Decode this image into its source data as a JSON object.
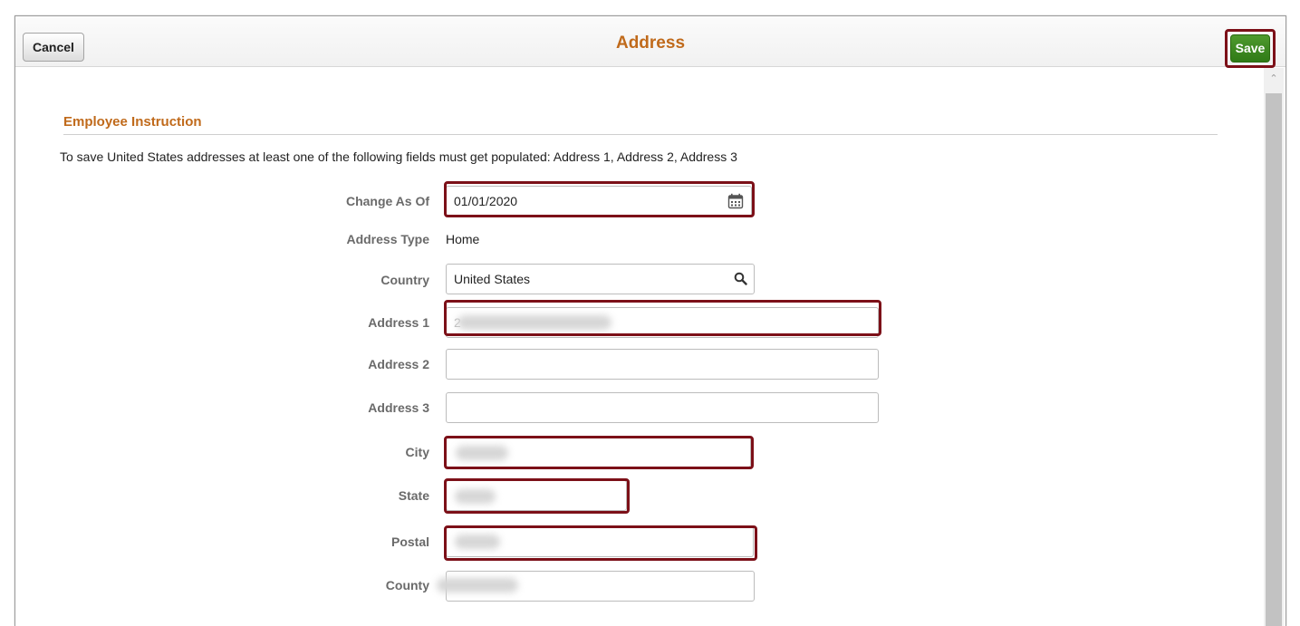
{
  "header": {
    "title": "Address",
    "cancel_label": "Cancel",
    "save_label": "Save"
  },
  "section": {
    "title": "Employee Instruction",
    "instruction": "To save United States addresses at least one of the following fields must get populated: Address 1, Address 2, Address 3"
  },
  "form": {
    "change_as_of": {
      "label": "Change As Of",
      "value": "01/01/2020"
    },
    "address_type": {
      "label": "Address Type",
      "value": "Home"
    },
    "country": {
      "label": "Country",
      "value": "United States"
    },
    "address1": {
      "label": "Address 1",
      "value": "2"
    },
    "address2": {
      "label": "Address 2",
      "value": ""
    },
    "address3": {
      "label": "Address 3",
      "value": ""
    },
    "city": {
      "label": "City"
    },
    "state": {
      "label": "State"
    },
    "postal": {
      "label": "Postal"
    },
    "county": {
      "label": "County"
    }
  },
  "icons": {
    "calendar": "calendar-icon",
    "lookup": "search-icon",
    "scroll_up": "chevron-up-icon"
  },
  "colors": {
    "accent": "#c06a1b",
    "highlight": "#7c1018",
    "save_bg": "#3a8a1e"
  }
}
